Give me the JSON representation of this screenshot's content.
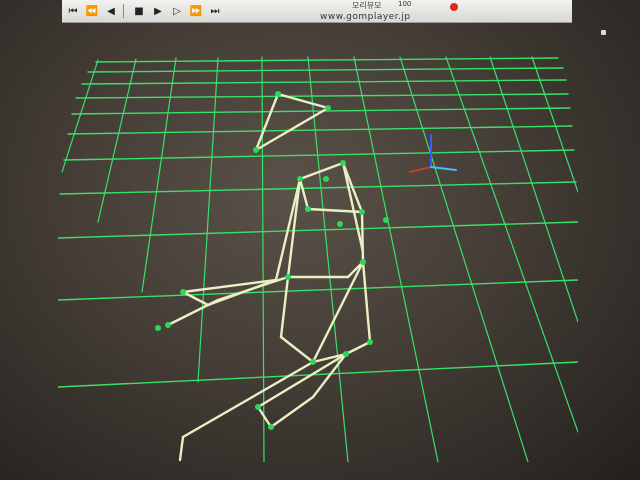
{
  "player": {
    "title": "모리뷰모",
    "url": "www.gomplayer.jp",
    "value": "100",
    "controls": [
      {
        "icon": "prev-track-icon",
        "glyph": "⏮"
      },
      {
        "icon": "rewind-icon",
        "glyph": "⏪"
      },
      {
        "icon": "step-back-icon",
        "glyph": "◀"
      },
      {
        "icon": "stop-icon",
        "glyph": "■"
      },
      {
        "icon": "play-icon",
        "glyph": "▶"
      },
      {
        "icon": "step-forward-icon",
        "glyph": "▷"
      },
      {
        "icon": "fast-forward-icon",
        "glyph": "⏩"
      },
      {
        "icon": "next-track-icon",
        "glyph": "⏭"
      }
    ]
  },
  "scene": {
    "grid_color": "#39e06a",
    "skeleton_color": "#e8f0c4",
    "joint_color": "#2bd85a",
    "axis_colors": {
      "y": "#3a5cff",
      "x": "#d03a2a",
      "z": "#40c0ff"
    }
  }
}
